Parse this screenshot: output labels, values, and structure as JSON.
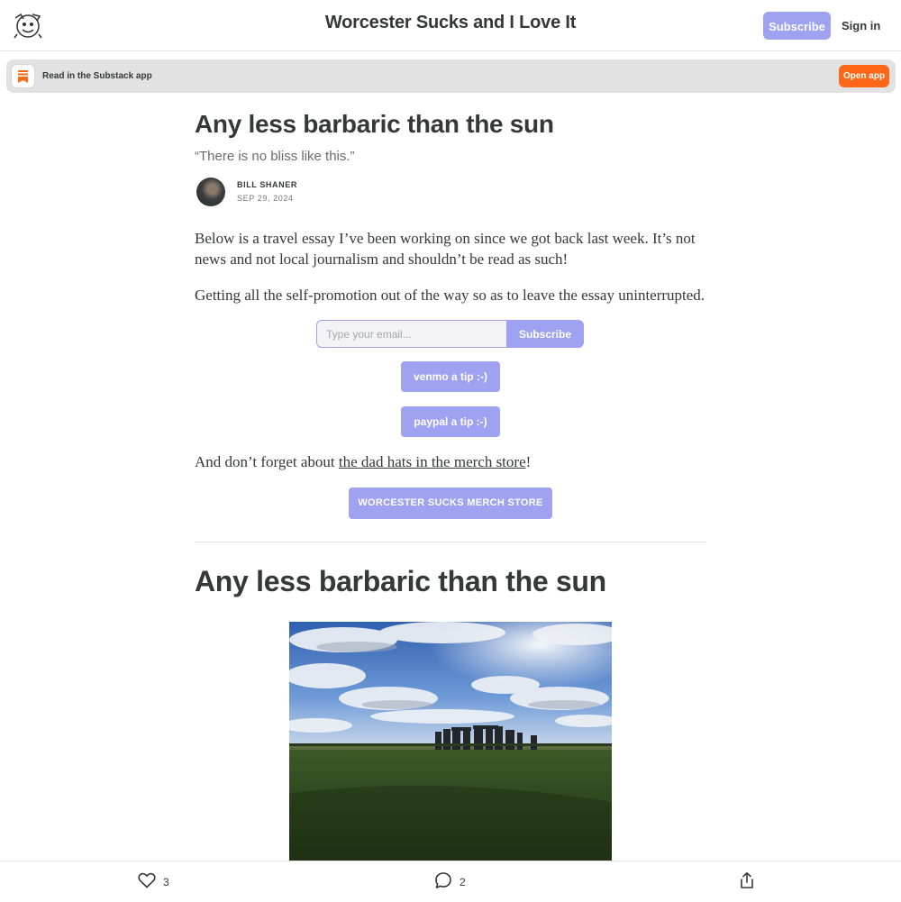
{
  "header": {
    "site_title": "Worcester Sucks and I Love It",
    "subscribe_label": "Subscribe",
    "signin_label": "Sign in"
  },
  "app_banner": {
    "text": "Read in the Substack app",
    "open_label": "Open app"
  },
  "post": {
    "title": "Any less barbaric than the sun",
    "subtitle": "“There is no bliss like this.”",
    "author": "BILL SHANER",
    "date": "SEP 29, 2024",
    "paragraph_1": "Below is a travel essay I’ve been working on since we got back last week. It’s not news and not local journalism and shouldn’t be read as such!",
    "paragraph_2": "Getting all the self-promotion out of the way so as to leave the essay uninterrupted.",
    "paragraph_3_prefix": "And don’t forget about ",
    "paragraph_3_link": "the dad hats in the merch store",
    "paragraph_3_suffix": "!",
    "section_heading": "Any less barbaric than the sun"
  },
  "subscribe_widget": {
    "email_placeholder": "Type your email...",
    "button_label": "Subscribe"
  },
  "buttons": {
    "venmo": "venmo a tip :-)",
    "paypal": "paypal a tip :-)",
    "merch": "WORCESTER SUCKS MERCH STORE"
  },
  "actions": {
    "likes": "3",
    "comments": "2"
  },
  "colors": {
    "accent": "#9ea2f0",
    "app_orange": "#ff6719",
    "text": "#363737"
  },
  "icons": {
    "like": "heart-icon",
    "comment": "comment-bubble-icon",
    "share": "share-icon",
    "app": "substack-bookmark-icon"
  }
}
